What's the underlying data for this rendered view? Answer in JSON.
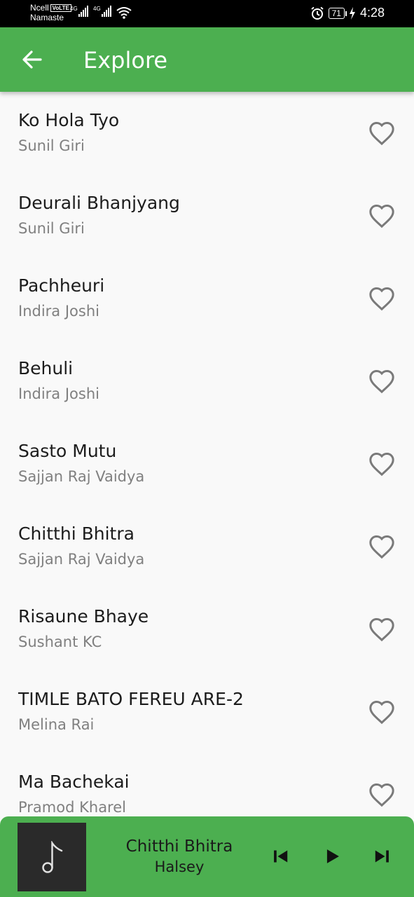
{
  "status_bar": {
    "carrier": "Ncell",
    "volte": "VoLTE",
    "operator_name": "Namaste",
    "network_1": "4G",
    "network_2": "4G",
    "battery": "71",
    "time": "4:28"
  },
  "appbar": {
    "back_icon": "arrow-left-icon",
    "title": "Explore"
  },
  "songs": [
    {
      "title": "Ko Hola Tyo",
      "artist": "Sunil Giri"
    },
    {
      "title": "Deurali Bhanjyang",
      "artist": "Sunil Giri"
    },
    {
      "title": "Pachheuri",
      "artist": "Indira Joshi"
    },
    {
      "title": "Behuli",
      "artist": "Indira Joshi"
    },
    {
      "title": "Sasto Mutu",
      "artist": "Sajjan Raj Vaidya"
    },
    {
      "title": "Chitthi Bhitra",
      "artist": "Sajjan Raj Vaidya"
    },
    {
      "title": "Risaune Bhaye",
      "artist": "Sushant KC"
    },
    {
      "title": "TIMLE BATO FEREU ARE-2",
      "artist": "Melina Rai"
    },
    {
      "title": "Ma Bachekai",
      "artist": "Pramod Kharel"
    }
  ],
  "now_playing": {
    "title": "Chitthi Bhitra",
    "artist": "Halsey",
    "art_icon": "music-note-icon"
  },
  "colors": {
    "accent": "#4caf50",
    "background": "#f9f9f9",
    "status_bar": "#000000",
    "album_art_bg": "#2a2a2a"
  }
}
